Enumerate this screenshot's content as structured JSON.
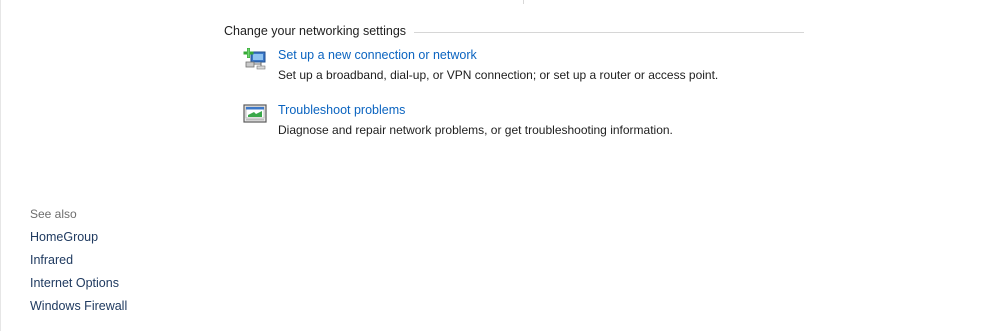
{
  "section": {
    "title": "Change your networking settings"
  },
  "tasks": [
    {
      "icon": "new-connection-icon",
      "link": "Set up a new connection or network",
      "description": "Set up a broadband, dial-up, or VPN connection; or set up a router or access point."
    },
    {
      "icon": "troubleshoot-icon",
      "link": "Troubleshoot problems",
      "description": "Diagnose and repair network problems, or get troubleshooting information."
    }
  ],
  "see_also": {
    "title": "See also",
    "links": [
      "HomeGroup",
      "Infrared",
      "Internet Options",
      "Windows Firewall"
    ]
  },
  "colors": {
    "link": "#0b64c0",
    "see_also_link": "#1f3a60",
    "muted": "#6d6d6d"
  }
}
